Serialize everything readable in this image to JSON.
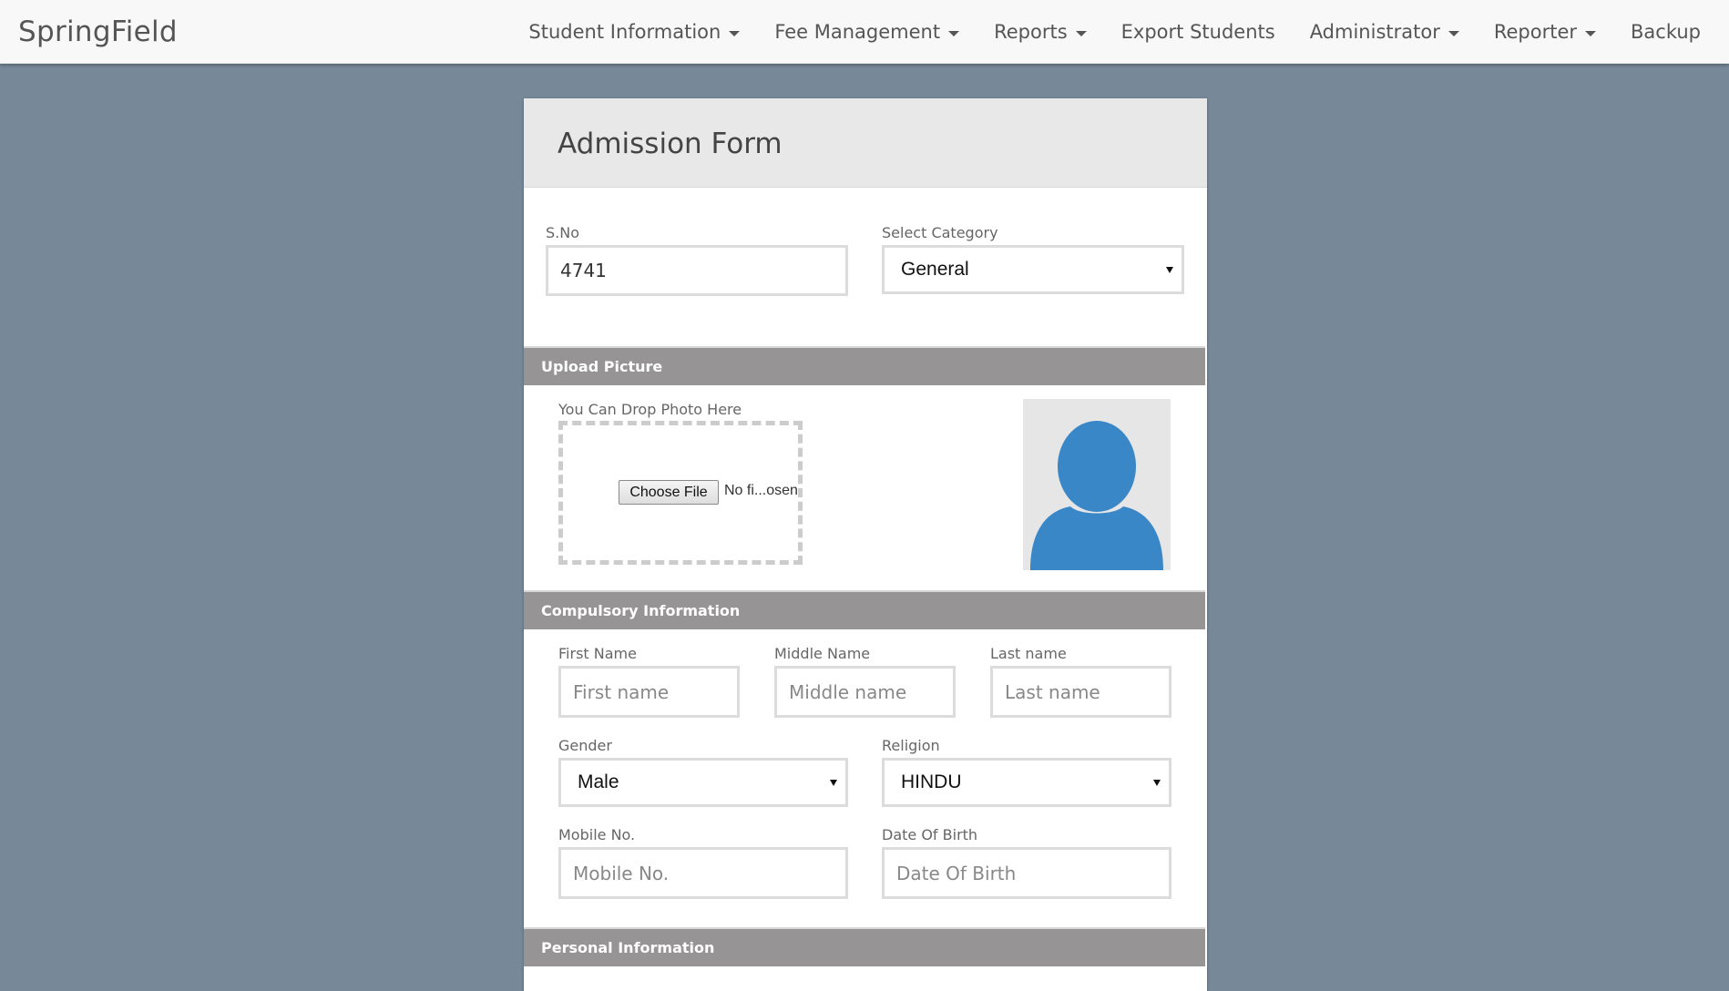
{
  "navbar": {
    "brand": "SpringField",
    "items": [
      {
        "label": "Student Information",
        "dropdown": true
      },
      {
        "label": "Fee Management",
        "dropdown": true
      },
      {
        "label": "Reports",
        "dropdown": true
      },
      {
        "label": "Export Students",
        "dropdown": false
      },
      {
        "label": "Administrator",
        "dropdown": true
      },
      {
        "label": "Reporter",
        "dropdown": true
      },
      {
        "label": "Backup",
        "dropdown": false
      }
    ]
  },
  "form": {
    "title": "Admission Form",
    "sno": {
      "label": "S.No",
      "value": "4741"
    },
    "category": {
      "label": "Select Category",
      "selected": "General"
    },
    "upload": {
      "section_title": "Upload Picture",
      "drop_label": "You Can Drop Photo Here",
      "choose_file_label": "Choose File",
      "file_status": "No fi...osen",
      "avatar_icon": "user-silhouette-icon"
    },
    "compulsory": {
      "section_title": "Compulsory Information",
      "first_name": {
        "label": "First Name",
        "placeholder": "First name",
        "value": ""
      },
      "middle_name": {
        "label": "Middle Name",
        "placeholder": "Middle name",
        "value": ""
      },
      "last_name": {
        "label": "Last name",
        "placeholder": "Last name",
        "value": ""
      },
      "gender": {
        "label": "Gender",
        "selected": "Male"
      },
      "religion": {
        "label": "Religion",
        "selected": "HINDU"
      },
      "mobile": {
        "label": "Mobile No.",
        "placeholder": "Mobile No.",
        "value": ""
      },
      "dob": {
        "label": "Date Of Birth",
        "placeholder": "Date Of Birth",
        "value": ""
      }
    },
    "personal": {
      "section_title": "Personal Information"
    }
  },
  "colors": {
    "background": "#778899",
    "section_bar": "#969494",
    "avatar_blue": "#3a87c8"
  }
}
